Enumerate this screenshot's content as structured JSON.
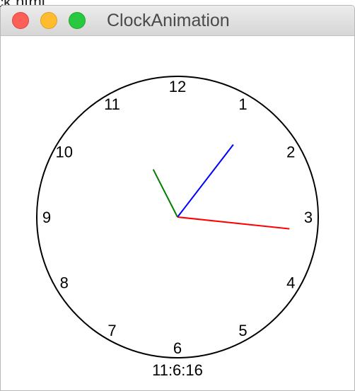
{
  "background_window": {
    "title_fragment": "ck.html"
  },
  "window": {
    "title": "ClockAnimation",
    "buttons": {
      "close_color": "#fe5f57",
      "minimize_color": "#febc2e",
      "maximize_color": "#28c840"
    }
  },
  "clock": {
    "numbers": [
      "12",
      "1",
      "2",
      "3",
      "4",
      "5",
      "6",
      "7",
      "8",
      "9",
      "10",
      "11"
    ],
    "time": {
      "hour": 11,
      "minute": 6,
      "second": 16
    },
    "digital_text": "11:6:16",
    "hand_colors": {
      "hour": "#008000",
      "minute": "#0000ff",
      "second": "#ff0000"
    }
  }
}
